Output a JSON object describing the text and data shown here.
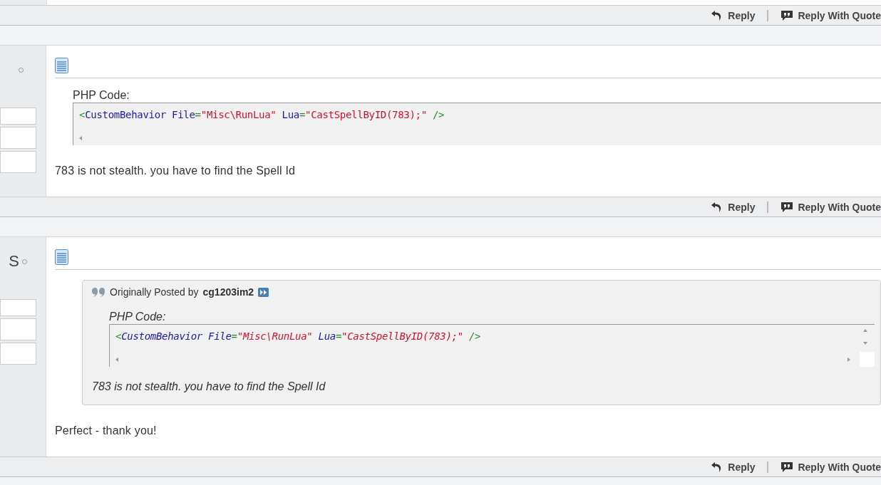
{
  "top_footer": {
    "actions": [
      {
        "kind": "reply",
        "label": "Reply"
      },
      {
        "kind": "quote",
        "label": "Reply With Quote"
      }
    ]
  },
  "posts": [
    {
      "blocks": [
        {
          "kind": "code",
          "label": "PHP Code:",
          "tokens": [
            {
              "kind": "punct",
              "text": "<"
            },
            {
              "kind": "tag",
              "text": "CustomBehavior"
            },
            {
              "kind": "attr",
              "text": " File"
            },
            {
              "kind": "punct",
              "text": "="
            },
            {
              "kind": "string",
              "text": "\"Misc\\RunLua\""
            },
            {
              "kind": "attr",
              "text": " Lua"
            },
            {
              "kind": "punct",
              "text": "="
            },
            {
              "kind": "string",
              "text": "\"CastSpellByID(783);\""
            },
            {
              "kind": "punct",
              "text": " />"
            }
          ]
        },
        {
          "kind": "text",
          "text": "783 is not stealth. you have to find the Spell Id"
        }
      ],
      "actions": [
        {
          "kind": "reply",
          "label": "Reply"
        },
        {
          "kind": "quote",
          "label": "Reply With Quote"
        }
      ]
    },
    {
      "sidebar": {
        "name_fragment": "S"
      },
      "blocks": [
        {
          "kind": "quote",
          "intro": "Originally Posted by",
          "author": "cg1203im2",
          "label": "PHP Code:",
          "tokens": [
            {
              "kind": "punct",
              "text": "<"
            },
            {
              "kind": "tag",
              "text": "CustomBehavior"
            },
            {
              "kind": "attr",
              "text": " File"
            },
            {
              "kind": "punct",
              "text": "="
            },
            {
              "kind": "string",
              "text": "\"Misc\\RunLua\""
            },
            {
              "kind": "attr",
              "text": " Lua"
            },
            {
              "kind": "punct",
              "text": "="
            },
            {
              "kind": "string",
              "text": "\"CastSpellByID(783);\""
            },
            {
              "kind": "punct",
              "text": " />"
            }
          ],
          "text": "783 is not stealth. you have to find the Spell Id"
        },
        {
          "kind": "text",
          "text": "Perfect - thank you!"
        }
      ],
      "actions": [
        {
          "kind": "reply",
          "label": "Reply"
        },
        {
          "kind": "quote",
          "label": "Reply With Quote"
        }
      ]
    }
  ]
}
